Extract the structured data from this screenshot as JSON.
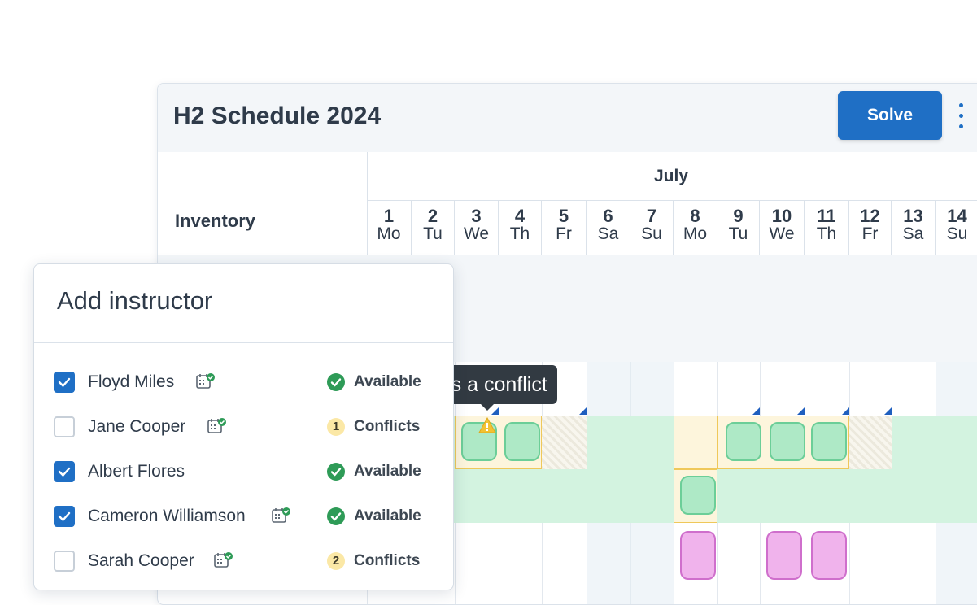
{
  "schedule": {
    "title": "H2 Schedule 2024",
    "solve_label": "Solve",
    "inventory_label": "Inventory",
    "month_label": "July",
    "days": [
      {
        "num": "1",
        "dow": "Mo"
      },
      {
        "num": "2",
        "dow": "Tu"
      },
      {
        "num": "3",
        "dow": "We"
      },
      {
        "num": "4",
        "dow": "Th"
      },
      {
        "num": "5",
        "dow": "Fr"
      },
      {
        "num": "6",
        "dow": "Sa"
      },
      {
        "num": "7",
        "dow": "Su"
      },
      {
        "num": "8",
        "dow": "Mo"
      },
      {
        "num": "9",
        "dow": "Tu"
      },
      {
        "num": "10",
        "dow": "We"
      },
      {
        "num": "11",
        "dow": "Th"
      },
      {
        "num": "12",
        "dow": "Fr"
      },
      {
        "num": "13",
        "dow": "Sa"
      },
      {
        "num": "14",
        "dow": "Su"
      }
    ]
  },
  "tooltip": {
    "text": "n has a conflict"
  },
  "add_instructor": {
    "title": "Add instructor",
    "instructors": [
      {
        "name": "Floyd Miles",
        "checked": true,
        "calendar_icon": true,
        "status": "Available",
        "status_type": "available",
        "count": ""
      },
      {
        "name": "Jane Cooper",
        "checked": false,
        "calendar_icon": true,
        "status": "Conflicts",
        "status_type": "conflict",
        "count": "1"
      },
      {
        "name": "Albert Flores",
        "checked": true,
        "calendar_icon": false,
        "status": "Available",
        "status_type": "available",
        "count": ""
      },
      {
        "name": "Cameron Williamson",
        "checked": true,
        "calendar_icon": true,
        "status": "Available",
        "status_type": "available",
        "count": ""
      },
      {
        "name": "Sarah Cooper",
        "checked": false,
        "calendar_icon": true,
        "status": "Conflicts",
        "status_type": "conflict",
        "count": "2"
      }
    ]
  },
  "colors": {
    "accent": "#1f6fc5",
    "available": "#2e9b57",
    "conflict_badge": "#fbe8a6",
    "event_green": "#aee9c6",
    "event_pink": "#f0b3ec",
    "highlight_yellow": "#fdf5dc"
  }
}
